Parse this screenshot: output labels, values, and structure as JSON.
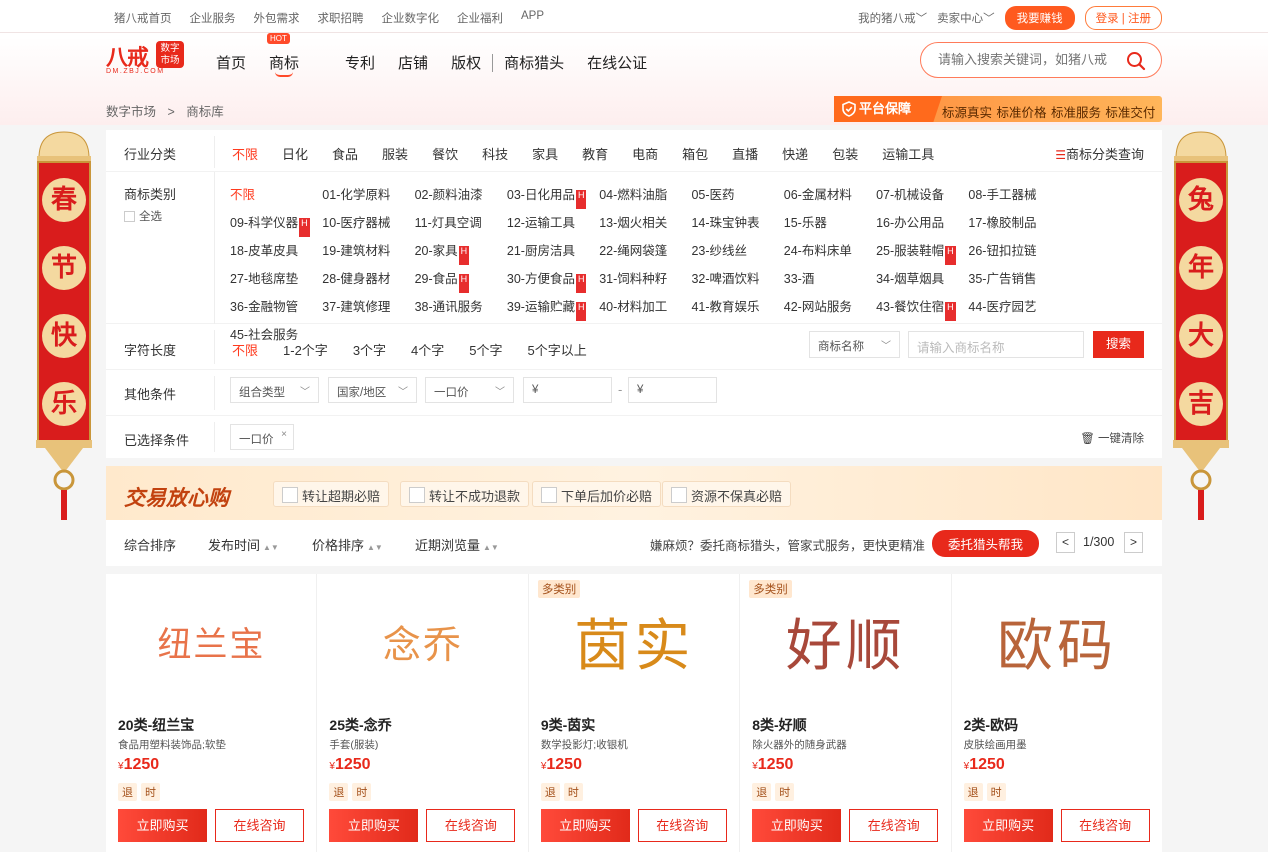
{
  "topbar": {
    "left": [
      "猪八戒首页",
      "企业服务",
      "外包需求",
      "求职招聘",
      "企业数字化",
      "企业福利",
      "APP"
    ],
    "my": "我的猪八戒",
    "seller": "卖家中心",
    "earn": "我要赚钱",
    "login": "登录",
    "register": "注册"
  },
  "logo": {
    "main": "八戒",
    "sub1": "数字",
    "sub2": "市场",
    "url": "DM.ZBJ.COM"
  },
  "nav": {
    "items": [
      "首页",
      "商标",
      "专利",
      "店铺",
      "版权",
      "商标猎头",
      "在线公证"
    ],
    "hot": "HOT"
  },
  "search": {
    "placeholder": "请输入搜索关键词，如猪八戒"
  },
  "breadcrumb": {
    "root": "数字市场",
    "sep": ">",
    "current": "商标库"
  },
  "guarantee": {
    "title": "平台保障",
    "items": "标源真实 标准价格 标准服务 标准交付"
  },
  "filters": {
    "industry_label": "行业分类",
    "industry": [
      "不限",
      "日化",
      "食品",
      "服装",
      "餐饮",
      "科技",
      "家具",
      "教育",
      "电商",
      "箱包",
      "直播",
      "快递",
      "包装",
      "运输工具"
    ],
    "class_query": "商标分类查询",
    "category_label": "商标类别",
    "select_all": "全选",
    "categories": [
      {
        "t": "不限",
        "h": false
      },
      {
        "t": "01-化学原料",
        "h": false
      },
      {
        "t": "02-颜料油漆",
        "h": false
      },
      {
        "t": "03-日化用品",
        "h": true
      },
      {
        "t": "04-燃料油脂",
        "h": false
      },
      {
        "t": "05-医药",
        "h": false
      },
      {
        "t": "06-金属材料",
        "h": false
      },
      {
        "t": "07-机械设备",
        "h": false
      },
      {
        "t": "08-手工器械",
        "h": false
      },
      {
        "t": "09-科学仪器",
        "h": true
      },
      {
        "t": "10-医疗器械",
        "h": false
      },
      {
        "t": "11-灯具空调",
        "h": false
      },
      {
        "t": "12-运输工具",
        "h": false
      },
      {
        "t": "13-烟火相关",
        "h": false
      },
      {
        "t": "14-珠宝钟表",
        "h": false
      },
      {
        "t": "15-乐器",
        "h": false
      },
      {
        "t": "16-办公用品",
        "h": false
      },
      {
        "t": "17-橡胶制品",
        "h": false
      },
      {
        "t": "18-皮革皮具",
        "h": false
      },
      {
        "t": "19-建筑材料",
        "h": false
      },
      {
        "t": "20-家具",
        "h": true
      },
      {
        "t": "21-厨房洁具",
        "h": false
      },
      {
        "t": "22-绳网袋篷",
        "h": false
      },
      {
        "t": "23-纱线丝",
        "h": false
      },
      {
        "t": "24-布料床单",
        "h": false
      },
      {
        "t": "25-服装鞋帽",
        "h": true
      },
      {
        "t": "26-钮扣拉链",
        "h": false
      },
      {
        "t": "27-地毯席垫",
        "h": false
      },
      {
        "t": "28-健身器材",
        "h": false
      },
      {
        "t": "29-食品",
        "h": true
      },
      {
        "t": "30-方便食品",
        "h": true
      },
      {
        "t": "31-饲料种籽",
        "h": false
      },
      {
        "t": "32-啤酒饮料",
        "h": false
      },
      {
        "t": "33-酒",
        "h": false
      },
      {
        "t": "34-烟草烟具",
        "h": false
      },
      {
        "t": "35-广告销售",
        "h": false
      },
      {
        "t": "36-金融物管",
        "h": false
      },
      {
        "t": "37-建筑修理",
        "h": false
      },
      {
        "t": "38-通讯服务",
        "h": false
      },
      {
        "t": "39-运输贮藏",
        "h": true
      },
      {
        "t": "40-材料加工",
        "h": false
      },
      {
        "t": "41-教育娱乐",
        "h": false
      },
      {
        "t": "42-网站服务",
        "h": false
      },
      {
        "t": "43-餐饮住宿",
        "h": true
      },
      {
        "t": "44-医疗园艺",
        "h": false
      },
      {
        "t": "45-社会服务",
        "h": false
      }
    ],
    "length_label": "字符长度",
    "lengths": [
      "不限",
      "1-2个字",
      "3个字",
      "4个字",
      "5个字",
      "5个字以上"
    ],
    "name_select": "商标名称",
    "name_placeholder": "请输入商标名称",
    "search_btn": "搜索",
    "other_label": "其他条件",
    "combo": "组合类型",
    "region": "国家/地区",
    "price_type": "一口价",
    "yuan": "¥",
    "dash": "-",
    "chosen_label": "已选择条件",
    "chosen_tag": "一口价",
    "clear": "一键清除"
  },
  "trust": {
    "title": "交易放心购",
    "items": [
      "转让超期必赔",
      "转让不成功退款",
      "下单后加价必赔",
      "资源不保真必赔"
    ]
  },
  "sort": {
    "items": [
      "综合排序",
      "发布时间",
      "价格排序",
      "近期浏览量"
    ],
    "hint": "嫌麻烦？委托商标猎头，管家式服务，更快更精准",
    "delegate": "委托猎头帮我",
    "prev": "<",
    "next": ">",
    "page": "1/300"
  },
  "couplets": {
    "left": [
      "春",
      "节",
      "快",
      "乐"
    ],
    "right": [
      "兔",
      "年",
      "大",
      "吉"
    ]
  },
  "products": [
    {
      "name": "纽兰宝",
      "title": "20类-纽兰宝",
      "desc": "食品用塑料装饰品;软垫",
      "price": "1250",
      "multi": "",
      "color": "#e8734a",
      "size": 34
    },
    {
      "name": "念乔",
      "title": "25类-念乔",
      "desc": "手套(服装)",
      "price": "1250",
      "multi": "",
      "color": "#e8934a",
      "size": 38
    },
    {
      "name": "茵实",
      "title": "9类-茵实",
      "desc": "数学投影灯;收银机",
      "price": "1250",
      "multi": "多类别",
      "color": "#d88a1a",
      "size": 56
    },
    {
      "name": "好顺",
      "title": "8类-好顺",
      "desc": "除火器外的随身武器",
      "price": "1250",
      "multi": "多类别",
      "color": "#a8483a",
      "size": 56
    },
    {
      "name": "欧码",
      "title": "2类-欧码",
      "desc": "皮肤绘画用墨",
      "price": "1250",
      "multi": "",
      "color": "#b8643a",
      "size": 56
    }
  ],
  "product_common": {
    "currency": "¥",
    "tag1": "退",
    "tag2": "时",
    "buy": "立即购买",
    "consult": "在线咨询"
  }
}
